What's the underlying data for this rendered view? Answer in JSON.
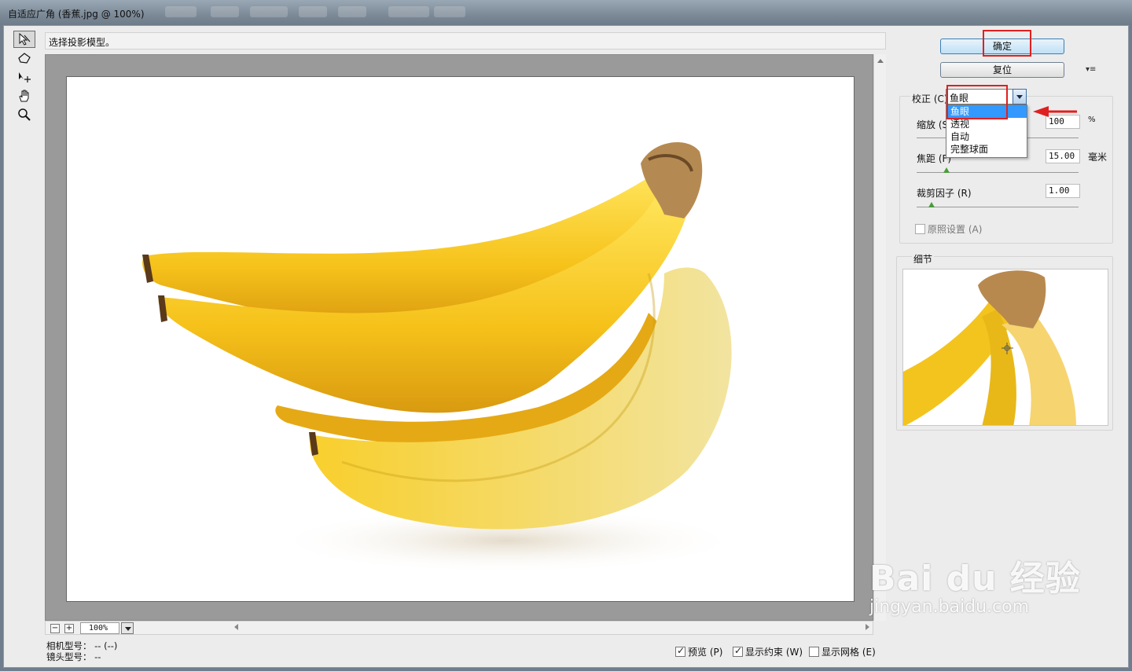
{
  "window": {
    "title": "自适应广角 (香蕉.jpg @ 100%)"
  },
  "hint": "选择投影模型。",
  "buttons": {
    "ok": "确定",
    "reset": "复位"
  },
  "correction": {
    "label": "校正 (C)：",
    "selected": "鱼眼",
    "options": [
      "鱼眼",
      "透视",
      "自动",
      "完整球面"
    ]
  },
  "params": {
    "scale": {
      "label": "缩放 (S)",
      "value": "100",
      "unit": "%"
    },
    "focal": {
      "label": "焦距 (F)",
      "value": "15.00",
      "unit": "毫米"
    },
    "crop": {
      "label": "裁剪因子 (R)",
      "value": "1.00"
    },
    "asshot": {
      "label": "原照设置 (A)",
      "checked": false
    }
  },
  "detail": {
    "label": "细节"
  },
  "zoom": {
    "value": "100%"
  },
  "camera": {
    "model_label": "相机型号：",
    "model_value": "-- (--)",
    "lens_label": "镜头型号：",
    "lens_value": "--"
  },
  "options": {
    "preview": {
      "label": "预览 (P)",
      "checked": true
    },
    "constraints": {
      "label": "显示约束 (W)",
      "checked": true
    },
    "grid": {
      "label": "显示网格 (E)",
      "checked": false
    }
  },
  "watermark": {
    "brand": "Bai du 经验",
    "url": "jingyan.baidu.com"
  },
  "colors": {
    "banana": "#f5c518",
    "annotation": "#e02020",
    "selection": "#3399ff"
  }
}
